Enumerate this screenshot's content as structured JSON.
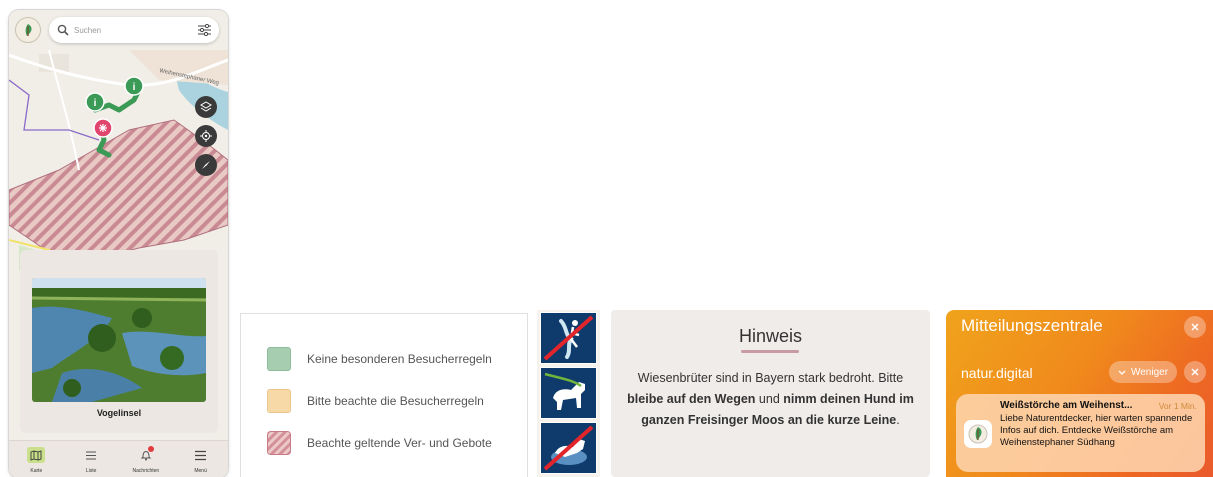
{
  "app": {
    "search": {
      "placeholder": "Suchen"
    },
    "map": {
      "street_label": "Weihenstephaner Weg"
    },
    "card": {
      "title": "Vogelinsel"
    },
    "bottom_nav": [
      {
        "label": "Karte",
        "icon": "map-icon",
        "active": true
      },
      {
        "label": "Liste",
        "icon": "list-icon",
        "active": false
      },
      {
        "label": "Nachrichten",
        "icon": "bell-icon",
        "active": false,
        "badge": true
      },
      {
        "label": "Menü",
        "icon": "menu-icon",
        "active": false
      }
    ],
    "colors": {
      "accent": "#c9df8b",
      "route": "#3b9a56",
      "poi_pink": "#e0456e",
      "restricted": "#c98a94"
    }
  },
  "legend": {
    "items": [
      {
        "label": "Keine besonderen Besucherregeln",
        "color": "#a7cdb1"
      },
      {
        "label": "Bitte beachte die Besucherregeln",
        "color": "#f7d8a7"
      },
      {
        "label": "Beachte geltende Ver- und Gebote",
        "color": "#d48f97"
      }
    ]
  },
  "signs": [
    {
      "icon": "no-entry-wetland-icon"
    },
    {
      "icon": "dog-on-leash-icon"
    },
    {
      "icon": "no-dog-off-leash-icon"
    }
  ],
  "hinweis": {
    "title": "Hinweis",
    "text_1": "Wiesenbrüter sind in Bayern stark bedroht. Bitte ",
    "bold_1": "bleibe auf den Wegen",
    "text_2": " und ",
    "bold_2": "nimm deinen Hund im ganzen Freisinger Moos an die",
    "text_3": " kurze Leine",
    "text_4": "."
  },
  "notification_center": {
    "title": "Mitteilungszentrale",
    "app_name": "natur.digital",
    "less_label": "Weniger",
    "notification": {
      "title": "Weißstörche am Weihenst...",
      "time": "Vor 1 Min.",
      "body": "Liebe Naturentdecker, hier warten spannende Infos auf dich. Entdecke Weißstörche am Weihenstephaner Südhang"
    }
  }
}
